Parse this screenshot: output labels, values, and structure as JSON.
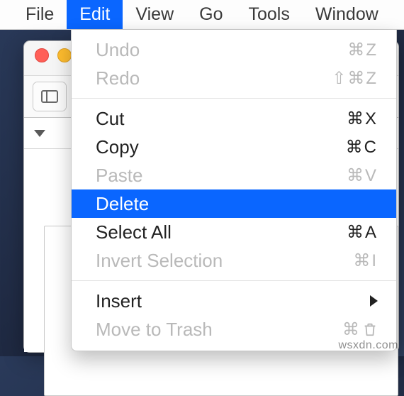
{
  "menubar": {
    "items": [
      "File",
      "Edit",
      "View",
      "Go",
      "Tools",
      "Window"
    ],
    "active_index": 1
  },
  "dropdown": {
    "groups": [
      [
        {
          "label": "Undo",
          "shortcut": "⌘Z",
          "disabled": true
        },
        {
          "label": "Redo",
          "shortcut": "⇧⌘Z",
          "disabled": true
        }
      ],
      [
        {
          "label": "Cut",
          "shortcut": "⌘X",
          "disabled": false
        },
        {
          "label": "Copy",
          "shortcut": "⌘C",
          "disabled": false
        },
        {
          "label": "Paste",
          "shortcut": "⌘V",
          "disabled": true
        },
        {
          "label": "Delete",
          "shortcut": "",
          "disabled": false,
          "selected": true
        },
        {
          "label": "Select All",
          "shortcut": "⌘A",
          "disabled": false
        },
        {
          "label": "Invert Selection",
          "shortcut": "⌘I",
          "disabled": true
        }
      ],
      [
        {
          "label": "Insert",
          "shortcut": "",
          "submenu": true,
          "disabled": false
        },
        {
          "label": "Move to Trash",
          "shortcut": "⌘",
          "trash": true,
          "disabled": true
        }
      ]
    ]
  },
  "watermark": "wsxdn.com"
}
